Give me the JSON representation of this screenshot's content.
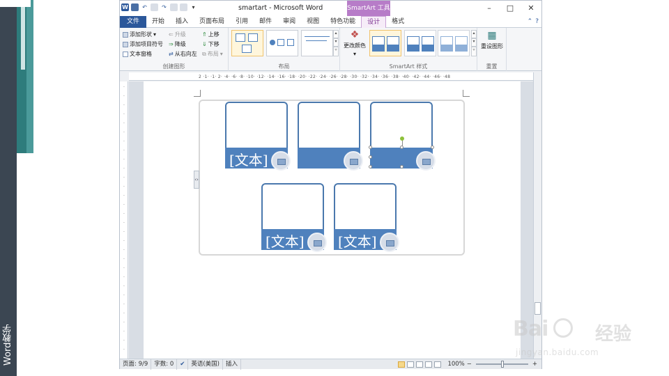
{
  "side_label": "Word教学",
  "window": {
    "title": "smartart - Microsoft Word",
    "context_tab_header": "SmartArt 工具",
    "controls": {
      "minimize": "–",
      "maximize": "□",
      "close": "✕"
    }
  },
  "tabs": [
    {
      "label": "文件"
    },
    {
      "label": "开始"
    },
    {
      "label": "插入"
    },
    {
      "label": "页面布局"
    },
    {
      "label": "引用"
    },
    {
      "label": "邮件"
    },
    {
      "label": "审阅"
    },
    {
      "label": "视图"
    },
    {
      "label": "特色功能"
    },
    {
      "label": "设计"
    },
    {
      "label": "格式"
    }
  ],
  "ribbon": {
    "create_graphic": {
      "label": "创建图形",
      "add_shape": "添加形状",
      "add_bullet": "添加项目符号",
      "text_pane": "文本窗格",
      "promote": "升级",
      "demote": "降级",
      "right_to_left": "从右向左",
      "move_up": "上移",
      "move_down": "下移",
      "layout": "布局"
    },
    "layouts": {
      "label": "布局"
    },
    "styles": {
      "label": "SmartArt 样式",
      "change_colors": "更改颜色"
    },
    "reset": {
      "label": "重置",
      "reset_graphic": "重设图形"
    }
  },
  "ruler": {
    "ticks": "2 ·1· ·1· 2· ·4· ·6· ·8· ·10· ·12· ·14· ·16· ·18· ·20· ·22· ·24· ·26· ·28· ·30· ·32· ·34· ·36· ·38· ·40· ·42· ·44· ·46· ·48"
  },
  "smartart": {
    "placeholder": "[文本]",
    "items": [
      {
        "text": "[文本]"
      },
      {
        "text": ""
      },
      {
        "text": ""
      },
      {
        "text": "[文本]"
      },
      {
        "text": "[文本]"
      }
    ]
  },
  "statusbar": {
    "page": "页面: 9/9",
    "words": "字数: 0",
    "language": "英语(美国)",
    "mode": "插入",
    "zoom": "100%",
    "zoom_out": "−",
    "zoom_in": "+"
  },
  "watermark": {
    "logo": "Bai",
    "logo2": "百度",
    "cn": "经验",
    "url": "jingyan.baidu.com"
  }
}
